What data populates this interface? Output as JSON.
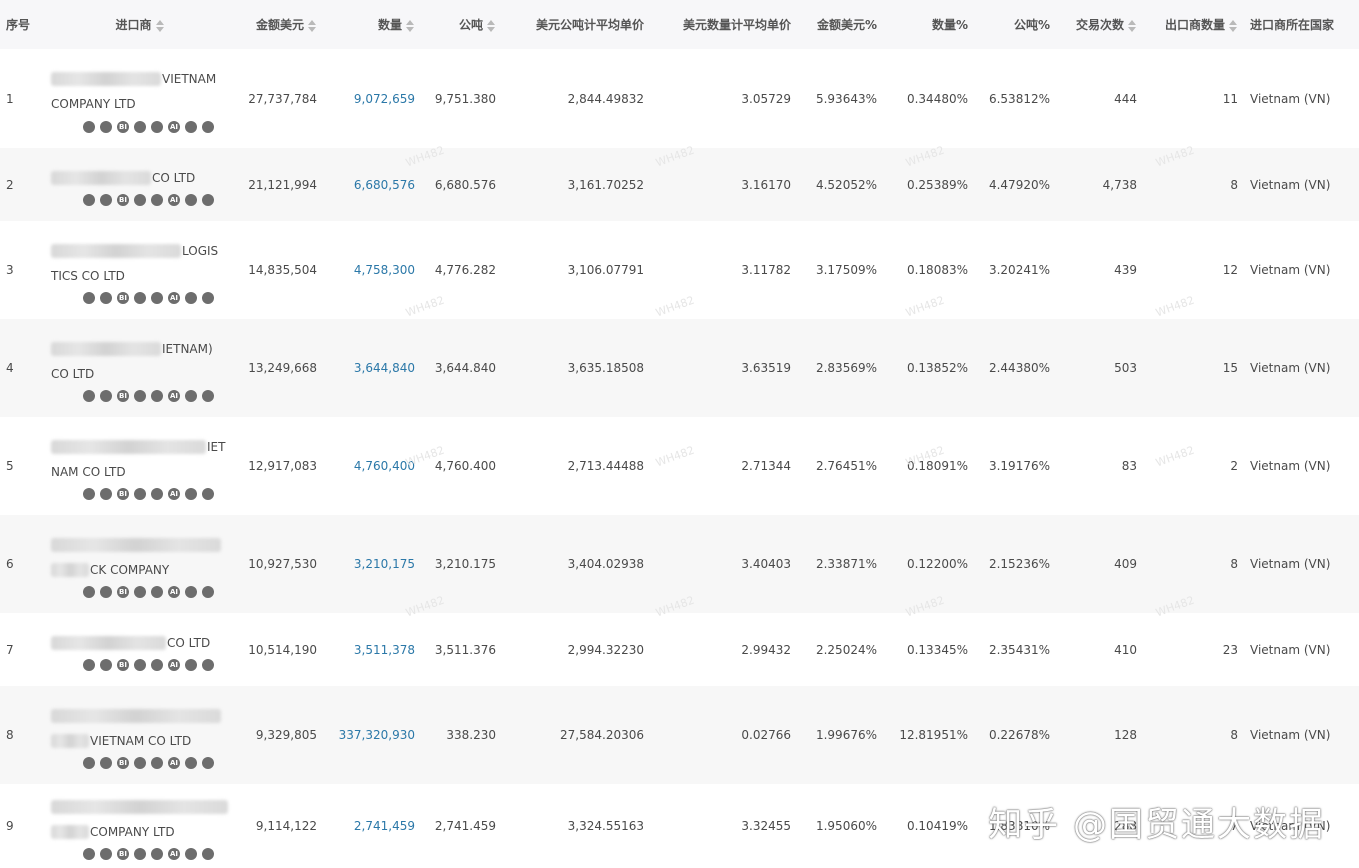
{
  "headers": {
    "idx": "序号",
    "importer": "进口商",
    "amount_usd": "金额美元",
    "quantity": "数量",
    "tons": "公吨",
    "usd_per_ton": "美元公吨计平均单价",
    "usd_per_qty": "美元数量计平均单价",
    "amount_pct": "金额美元%",
    "qty_pct": "数量%",
    "ton_pct": "公吨%",
    "trades": "交易次数",
    "exporters": "出口商数量",
    "country": "进口商所在国家"
  },
  "icon_labels": [
    "BI",
    "AI"
  ],
  "rows": [
    {
      "idx": "1",
      "line1": "VIETNAM",
      "line2": "COMPANY LTD",
      "amount": "27,737,784",
      "qty": "9,072,659",
      "tons": "9,751.380",
      "usd_ton": "2,844.49832",
      "usd_qty": "3.05729",
      "amt_pct": "5.93643%",
      "qty_pct": "0.34480%",
      "ton_pct": "6.53812%",
      "trades": "444",
      "exporters": "11",
      "country": "Vietnam (VN)"
    },
    {
      "idx": "2",
      "line1": "CO LTD",
      "line2": "",
      "amount": "21,121,994",
      "qty": "6,680,576",
      "tons": "6,680.576",
      "usd_ton": "3,161.70252",
      "usd_qty": "3.16170",
      "amt_pct": "4.52052%",
      "qty_pct": "0.25389%",
      "ton_pct": "4.47920%",
      "trades": "4,738",
      "exporters": "8",
      "country": "Vietnam (VN)"
    },
    {
      "idx": "3",
      "line1": "LOGIS",
      "line2": "TICS CO LTD",
      "amount": "14,835,504",
      "qty": "4,758,300",
      "tons": "4,776.282",
      "usd_ton": "3,106.07791",
      "usd_qty": "3.11782",
      "amt_pct": "3.17509%",
      "qty_pct": "0.18083%",
      "ton_pct": "3.20241%",
      "trades": "439",
      "exporters": "12",
      "country": "Vietnam (VN)"
    },
    {
      "idx": "4",
      "line1": "IETNAM)",
      "line2": "CO LTD",
      "amount": "13,249,668",
      "qty": "3,644,840",
      "tons": "3,644.840",
      "usd_ton": "3,635.18508",
      "usd_qty": "3.63519",
      "amt_pct": "2.83569%",
      "qty_pct": "0.13852%",
      "ton_pct": "2.44380%",
      "trades": "503",
      "exporters": "15",
      "country": "Vietnam (VN)"
    },
    {
      "idx": "5",
      "line1": "IET",
      "line2": "NAM CO LTD",
      "amount": "12,917,083",
      "qty": "4,760,400",
      "tons": "4,760.400",
      "usd_ton": "2,713.44488",
      "usd_qty": "2.71344",
      "amt_pct": "2.76451%",
      "qty_pct": "0.18091%",
      "ton_pct": "3.19176%",
      "trades": "83",
      "exporters": "2",
      "country": "Vietnam (VN)"
    },
    {
      "idx": "6",
      "line1": "",
      "line2": "CK COMPANY",
      "amount": "10,927,530",
      "qty": "3,210,175",
      "tons": "3,210.175",
      "usd_ton": "3,404.02938",
      "usd_qty": "3.40403",
      "amt_pct": "2.33871%",
      "qty_pct": "0.12200%",
      "ton_pct": "2.15236%",
      "trades": "409",
      "exporters": "8",
      "country": "Vietnam (VN)"
    },
    {
      "idx": "7",
      "line1": "CO LTD",
      "line2": "",
      "amount": "10,514,190",
      "qty": "3,511,378",
      "tons": "3,511.376",
      "usd_ton": "2,994.32230",
      "usd_qty": "2.99432",
      "amt_pct": "2.25024%",
      "qty_pct": "0.13345%",
      "ton_pct": "2.35431%",
      "trades": "410",
      "exporters": "23",
      "country": "Vietnam (VN)"
    },
    {
      "idx": "8",
      "line1": "",
      "line2": "VIETNAM CO LTD",
      "amount": "9,329,805",
      "qty": "337,320,930",
      "tons": "338.230",
      "usd_ton": "27,584.20306",
      "usd_qty": "0.02766",
      "amt_pct": "1.99676%",
      "qty_pct": "12.81951%",
      "ton_pct": "0.22678%",
      "trades": "128",
      "exporters": "8",
      "country": "Vietnam (VN)"
    },
    {
      "idx": "9",
      "line1": "",
      "line2": "COMPANY LTD",
      "amount": "9,114,122",
      "qty": "2,741,459",
      "tons": "2,741.459",
      "usd_ton": "3,324.55163",
      "usd_qty": "3.32455",
      "amt_pct": "1.95060%",
      "qty_pct": "0.10419%",
      "ton_pct": "1.83810%",
      "trades": "288",
      "exporters": "7",
      "country": "Vietnam (VN)"
    }
  ],
  "watermark": "知乎 @国贸通大数据",
  "bg_watermark": "WH482"
}
